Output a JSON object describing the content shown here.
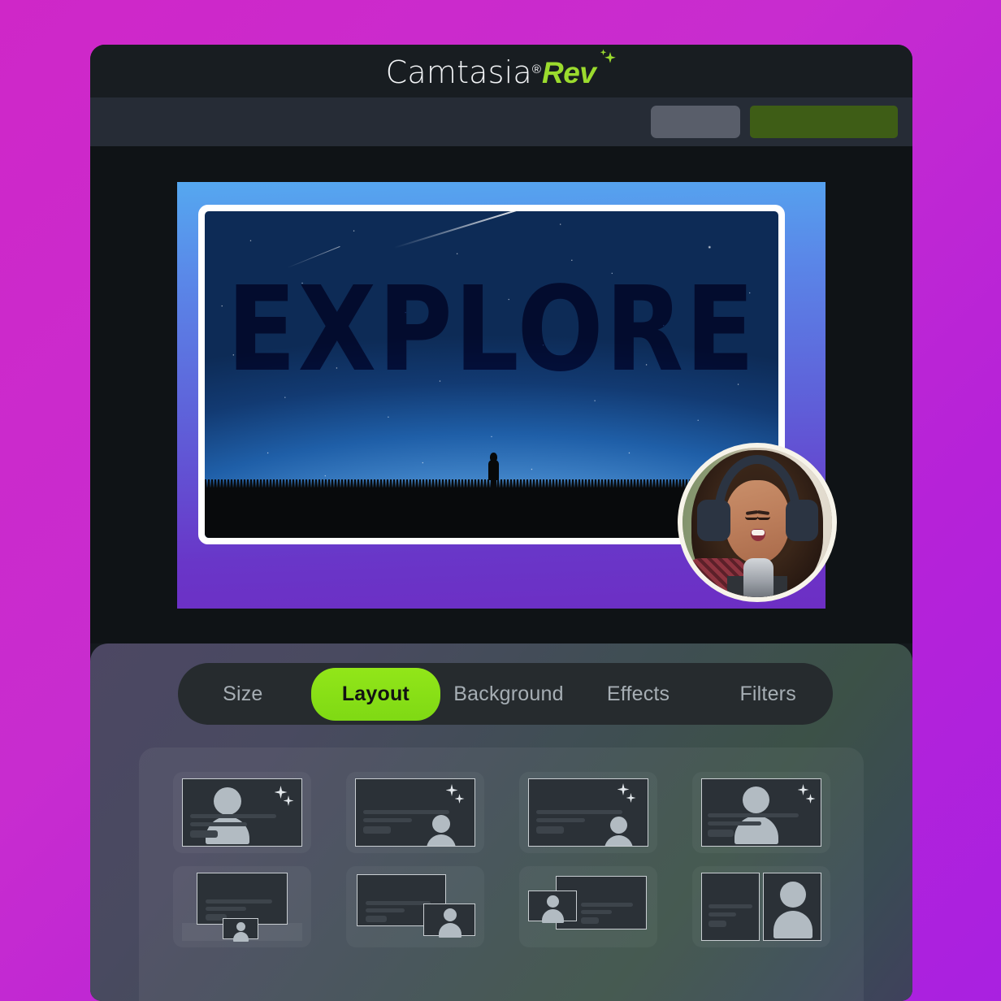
{
  "app": {
    "brand_primary": "Camtasia",
    "brand_registered": "®",
    "brand_secondary": "Rev",
    "brand_sparkle_icon": "sparkle-icon",
    "accent_green": "#92e619",
    "logo_green": "#9bdb2e",
    "background_magenta": "#cf27c8",
    "background_purple": "#a921e0"
  },
  "toolbar": {
    "secondary_button_label": "",
    "secondary_button_color": "#595e6a",
    "primary_button_label": "",
    "primary_button_color": "#3e5d16"
  },
  "stage": {
    "canvas_gradient_top": "#55a8f0",
    "canvas_gradient_bottom": "#6d2ec4",
    "video_title": "EXPLORE",
    "video_title_color": "#18357e",
    "video_frame_color": "#ffffff",
    "scene_description": "starry-night-sky",
    "silhouette_icon": "person-silhouette-icon",
    "meteor_icon": "meteor-streak-icon",
    "webcam": {
      "name": "webcam-bubble",
      "border_color": "#f7f4ea",
      "subject": "presenter-with-headphones-and-microphone"
    }
  },
  "tabs": [
    {
      "label": "Size",
      "active": false
    },
    {
      "label": "Layout",
      "active": true
    },
    {
      "label": "Background",
      "active": false
    },
    {
      "label": "Effects",
      "active": false
    },
    {
      "label": "Filters",
      "active": false
    }
  ],
  "layouts": {
    "rows": [
      [
        {
          "name": "layout-person-left-large",
          "variant": "person-left-large"
        },
        {
          "name": "layout-person-right-small",
          "variant": "person-right-small"
        },
        {
          "name": "layout-person-right-corner",
          "variant": "person-right-corner"
        },
        {
          "name": "layout-person-center-large",
          "variant": "person-center-large"
        }
      ],
      [
        {
          "name": "layout-screen-with-bottom-pip",
          "variant": "screen-bottom-pip"
        },
        {
          "name": "layout-screen-with-right-pip",
          "variant": "screen-right-pip"
        },
        {
          "name": "layout-screen-with-left-pip",
          "variant": "screen-left-pip"
        },
        {
          "name": "layout-split-screen-person",
          "variant": "split-screen-person"
        }
      ]
    ]
  }
}
